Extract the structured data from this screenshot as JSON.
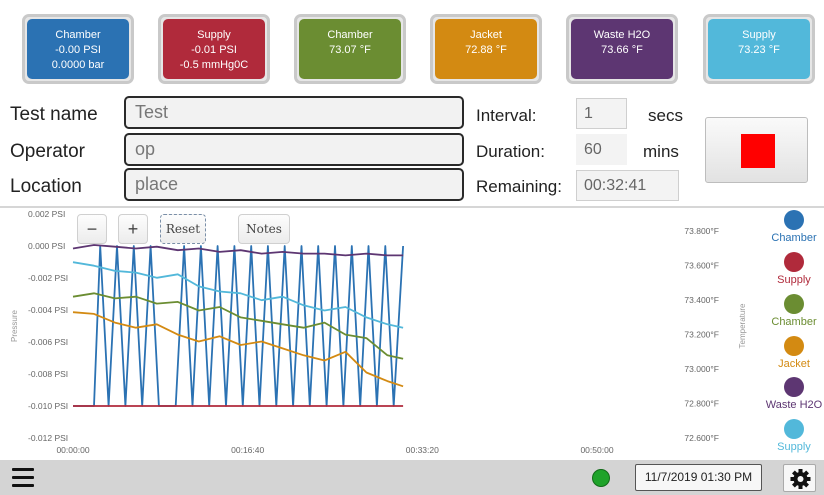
{
  "tiles": [
    {
      "label": "Chamber",
      "line1": "-0.00 PSI",
      "line2": "0.0000 bar",
      "color": "#2b72b3"
    },
    {
      "label": "Supply",
      "line1": "-0.01 PSI",
      "line2": "-0.5 mmHg0C",
      "color": "#b02a3b"
    },
    {
      "label": "Chamber",
      "line1": "73.07 °F",
      "line2": "",
      "color": "#6b8d32"
    },
    {
      "label": "Jacket",
      "line1": "72.88 °F",
      "line2": "",
      "color": "#d38a12"
    },
    {
      "label": "Waste H2O",
      "line1": "73.66 °F",
      "line2": "",
      "color": "#5d3672"
    },
    {
      "label": "Supply",
      "line1": "73.23 °F",
      "line2": "",
      "color": "#52b8da"
    }
  ],
  "form": {
    "test_name_label": "Test name",
    "test_name_value": "Test",
    "operator_label": "Operator",
    "operator_value": "op",
    "location_label": "Location",
    "location_value": "place",
    "interval_label": "Interval:",
    "interval_value": "1",
    "interval_unit": "secs",
    "duration_label": "Duration:",
    "duration_value": "60",
    "duration_unit": "mins",
    "remaining_label": "Remaining:",
    "remaining_value": "00:32:41"
  },
  "chart_controls": {
    "zoom_out": "−",
    "zoom_in": "+",
    "reset": "Reset",
    "notes": "Notes"
  },
  "chart_data": {
    "type": "line",
    "ylabel_left": "Pressure",
    "ylabel_right": "Temperature",
    "left_ticks": [
      "0.002 PSI",
      "0.000 PSI",
      "-0.002 PSI",
      "-0.004 PSI",
      "-0.006 PSI",
      "-0.008 PSI",
      "-0.010 PSI",
      "-0.012 PSI"
    ],
    "right_ticks": [
      "73.800°F",
      "73.600°F",
      "73.400°F",
      "73.200°F",
      "73.000°F",
      "72.800°F",
      "72.600°F"
    ],
    "x_ticks": [
      "00:00:00",
      "00:16:40",
      "00:33:20",
      "00:50:00"
    ],
    "ylim_left": [
      -0.012,
      0.002
    ],
    "ylim_right": [
      72.6,
      73.9
    ],
    "x_minutes_shown": [
      0,
      16.67,
      33.33,
      50
    ],
    "series": [
      {
        "name": "Chamber",
        "axis": "pressure",
        "color": "#2b72b3",
        "t": [
          0,
          2,
          2.6,
          3.4,
          4.2,
          5,
          5.8,
          6.6,
          7.4,
          8.2,
          9,
          9.8,
          10.6,
          11.4,
          12.2,
          13,
          13.8,
          14.6,
          15.4,
          16.2,
          17,
          17.8,
          18.6,
          19.4,
          20.2,
          21,
          21.8,
          22.6,
          23.4,
          24.2,
          25,
          25.8,
          26.6,
          27.4,
          28.2,
          29,
          29.8,
          30.6,
          31.5
        ],
        "v": [
          -0.01,
          -0.01,
          0.0,
          -0.01,
          0.0,
          -0.01,
          0.0,
          -0.01,
          0.0,
          -0.01,
          -0.01,
          -0.01,
          0.0,
          -0.01,
          0.0,
          -0.01,
          0.0,
          -0.01,
          0.0,
          -0.01,
          0.0,
          -0.01,
          0.0,
          -0.01,
          0.0,
          -0.01,
          0.0,
          -0.01,
          0.0,
          -0.01,
          0.0,
          -0.01,
          0.0,
          -0.01,
          0.0,
          -0.01,
          0.0,
          -0.01,
          0.0
        ]
      },
      {
        "name": "Supply",
        "axis": "pressure",
        "color": "#b02a3b",
        "t": [
          0,
          31.5
        ],
        "v": [
          -0.01,
          -0.01
        ]
      },
      {
        "name": "Chamber",
        "axis": "temperature",
        "color": "#6b8d32",
        "t": [
          0,
          2,
          4,
          6,
          8,
          10,
          12,
          14,
          16,
          18,
          20,
          22,
          24,
          26,
          28,
          30,
          31.5
        ],
        "v": [
          73.42,
          73.44,
          73.41,
          73.42,
          73.38,
          73.39,
          73.34,
          73.36,
          73.3,
          73.28,
          73.26,
          73.24,
          73.27,
          73.2,
          73.18,
          73.08,
          73.06
        ]
      },
      {
        "name": "Jacket",
        "axis": "temperature",
        "color": "#d38a12",
        "t": [
          0,
          2,
          4,
          6,
          8,
          10,
          12,
          14,
          16,
          18,
          20,
          22,
          24,
          26,
          28,
          30,
          31.5
        ],
        "v": [
          73.33,
          73.32,
          73.27,
          73.24,
          73.26,
          73.2,
          73.16,
          73.19,
          73.14,
          73.16,
          73.12,
          73.08,
          73.05,
          73.1,
          72.98,
          72.93,
          72.9
        ]
      },
      {
        "name": "Waste H2O",
        "axis": "temperature",
        "color": "#5d3672",
        "t": [
          0,
          2,
          4,
          6,
          8,
          10,
          12,
          14,
          16,
          18,
          20,
          22,
          24,
          26,
          28,
          30,
          31.5
        ],
        "v": [
          73.7,
          73.72,
          73.71,
          73.7,
          73.71,
          73.69,
          73.7,
          73.68,
          73.69,
          73.67,
          73.68,
          73.67,
          73.67,
          73.66,
          73.67,
          73.66,
          73.66
        ]
      },
      {
        "name": "Supply",
        "axis": "temperature",
        "color": "#52b8da",
        "t": [
          0,
          2,
          4,
          6,
          8,
          10,
          12,
          14,
          16,
          18,
          20,
          22,
          24,
          26,
          28,
          30,
          31.5
        ],
        "v": [
          73.62,
          73.6,
          73.57,
          73.56,
          73.53,
          73.55,
          73.48,
          73.45,
          73.44,
          73.4,
          73.42,
          73.37,
          73.34,
          73.36,
          73.3,
          73.26,
          73.24
        ]
      }
    ]
  },
  "legend": [
    {
      "label": "Chamber",
      "color": "#2b72b3"
    },
    {
      "label": "Supply",
      "color": "#b02a3b"
    },
    {
      "label": "Chamber",
      "color": "#6b8d32"
    },
    {
      "label": "Jacket",
      "color": "#d38a12"
    },
    {
      "label": "Waste H2O",
      "color": "#5d3672"
    },
    {
      "label": "Supply",
      "color": "#52b8da"
    }
  ],
  "status": {
    "datetime": "11/7/2019 01:30 PM",
    "connection_color": "#1fa32a"
  },
  "icons": {
    "menu": "hamburger-menu-icon",
    "settings": "gear-icon",
    "stop": "stop-icon"
  }
}
